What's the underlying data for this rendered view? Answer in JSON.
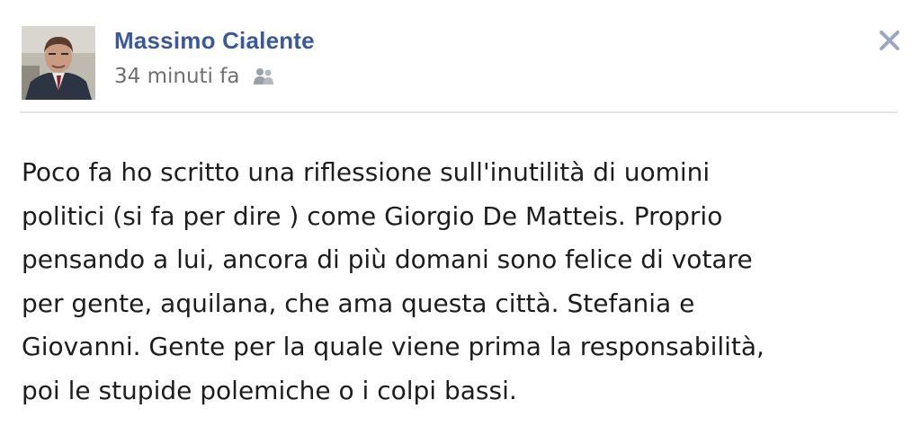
{
  "post": {
    "author": {
      "name": "Massimo Cialente",
      "avatar_icon": "profile-photo"
    },
    "timestamp": "34 minuti fa",
    "audience_icon": "friends-audience-icon",
    "close_icon": "close-icon",
    "body": "Poco fa ho scritto una riflessione sull'inutilità di uomini\npolitici (si fa per dire ) come Giorgio De Matteis. Proprio\npensando a lui, ancora di più domani sono felice di votare\nper gente, aquilana, che ama questa città. Stefania e\nGiovanni. Gente per la quale viene prima la responsabilità,\npoi le stupide polemiche o i colpi bassi."
  },
  "colors": {
    "author_link": "#3b5998",
    "meta_text": "#6f6f6f",
    "body_text": "#1d1d1d",
    "divider": "#e5e5e5",
    "close_icon": "#9aa6c4"
  }
}
